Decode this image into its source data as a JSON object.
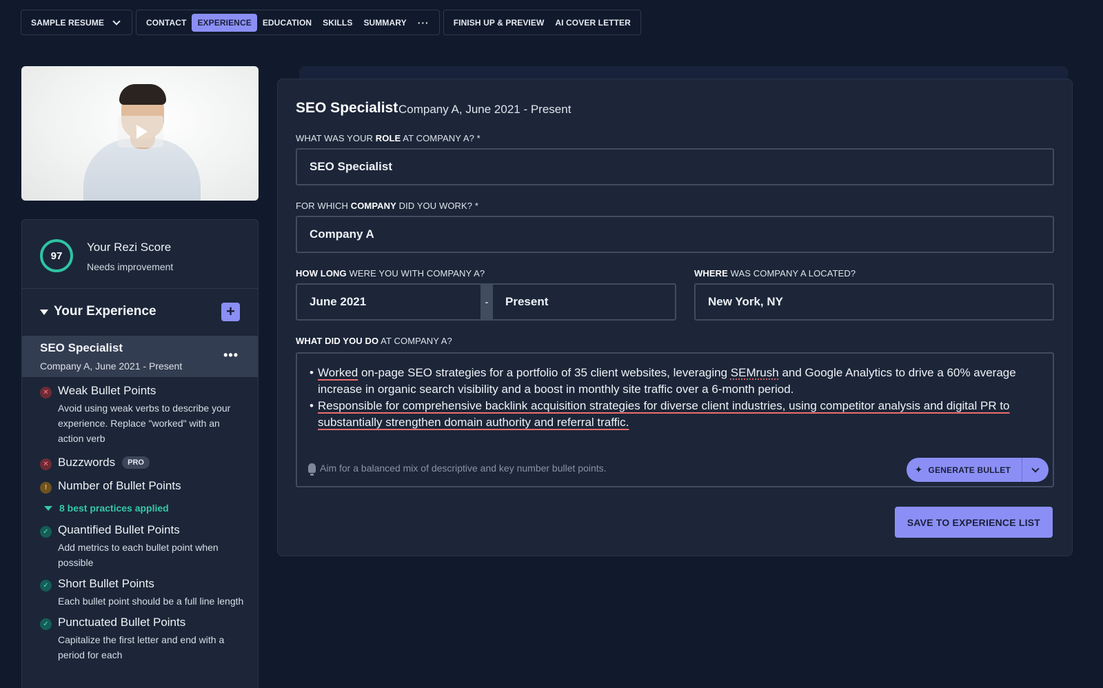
{
  "nav": {
    "resume_label": "SAMPLE RESUME",
    "tabs": [
      {
        "label": "CONTACT"
      },
      {
        "label": "EXPERIENCE"
      },
      {
        "label": "EDUCATION"
      },
      {
        "label": "SKILLS"
      },
      {
        "label": "SUMMARY"
      },
      {
        "label": "···"
      }
    ],
    "active_tab": "EXPERIENCE",
    "finish_label": "FINISH UP & PREVIEW",
    "cover_label": "AI COVER LETTER"
  },
  "video": {
    "play_icon": "play-icon"
  },
  "score": {
    "value": "97",
    "title": "Your Rezi Score",
    "status": "Needs improvement",
    "ring_color": "#2fc3a4"
  },
  "experience": {
    "title": "Your Experience",
    "add_icon": "+",
    "item": {
      "title": "SEO Specialist",
      "subtitle": "Company A, June 2021 - Present",
      "more_icon": "•••"
    }
  },
  "checks": {
    "weak": {
      "title": "Weak Bullet Points",
      "desc": "Avoid using weak verbs to describe your experience. Replace \"worked\" with an action verb",
      "icon": "✕"
    },
    "buzz": {
      "title": "Buzzwords",
      "badge": "PRO",
      "icon": "✕"
    },
    "count": {
      "title": "Number of Bullet Points",
      "icon": "!"
    },
    "practices": "8 best practices applied",
    "quant": {
      "title": "Quantified Bullet Points",
      "desc": "Add metrics to each bullet point when possible",
      "icon": "✓"
    },
    "short": {
      "title": "Short Bullet Points",
      "desc": "Each bullet point should be a full line length",
      "icon": "✓"
    },
    "punct": {
      "title": "Punctuated Bullet Points",
      "desc": "Capitalize the first letter and end with a period for each",
      "icon": "✓"
    }
  },
  "form": {
    "title": "SEO Specialist",
    "subtitle": "Company A, June 2021 - Present",
    "role_label": {
      "pre": "WHAT WAS YOUR ",
      "bold": "ROLE",
      "post": " AT COMPANY A? *"
    },
    "role_value": "SEO Specialist",
    "company_label": {
      "pre": "FOR WHICH ",
      "bold": "COMPANY",
      "post": " DID YOU WORK? *"
    },
    "company_value": "Company A",
    "howlong_label": {
      "bold": "HOW LONG",
      "post": " WERE YOU WITH COMPANY A?"
    },
    "start_value": "June 2021",
    "date_sep": "-",
    "end_value": "Present",
    "where_label": {
      "bold": "WHERE",
      "post": " WAS COMPANY A LOCATED?"
    },
    "where_value": "New York, NY",
    "what_label": {
      "bold": "WHAT DID YOU DO",
      "post": " AT COMPANY A?"
    },
    "bullet1": {
      "w1": "Worked",
      "t1": " on-page SEO strategies for a portfolio of 35 client websites, leveraging ",
      "w2": "SEMrush",
      "t2": " and Google Analytics to drive a 60% average increase in organic search visibility and a boost in monthly site traffic over a 6-month period."
    },
    "bullet2": "Responsible for comprehensive backlink acquisition strategies for diverse client industries, using competitor analysis and digital PR to substantially strengthen domain authority and referral traffic.",
    "hint": "Aim for a balanced mix of descriptive and key number bullet points.",
    "generate_label": "GENERATE BULLET",
    "save_label": "SAVE TO EXPERIENCE LIST"
  },
  "colors": {
    "accent": "#8b8ff5",
    "background": "#111a2c",
    "panel": "#1c2638",
    "good": "#35c9a7",
    "bad": "#f06c6c"
  }
}
